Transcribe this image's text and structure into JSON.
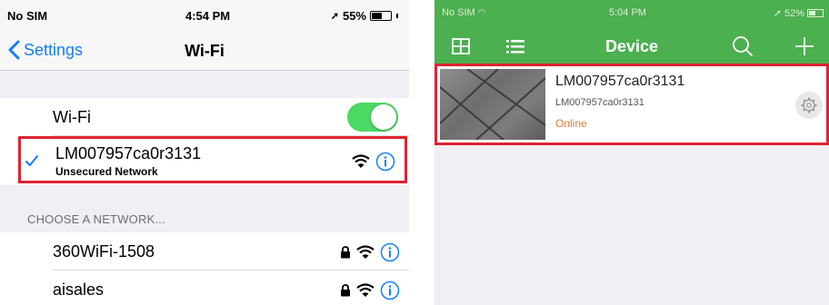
{
  "left": {
    "status": {
      "carrier": "No SIM",
      "time": "4:54 PM",
      "battery": "55%",
      "battery_level": 0.55
    },
    "nav": {
      "back_label": "Settings",
      "title": "Wi-Fi"
    },
    "wifi_toggle": {
      "label": "Wi-Fi",
      "on": true
    },
    "connected_network": {
      "name": "LM007957ca0r3131",
      "subtitle": "Unsecured Network"
    },
    "section_header": "CHOOSE A NETWORK...",
    "networks": [
      {
        "name": "360WiFi-1508",
        "secured": true
      },
      {
        "name": "aisales",
        "secured": true
      }
    ]
  },
  "right": {
    "status": {
      "carrier": "No SIM",
      "time": "5:04 PM",
      "battery": "52%",
      "battery_level": 0.52
    },
    "toolbar": {
      "title": "Device"
    },
    "device": {
      "name": "LM007957ca0r3131",
      "id": "LM007957ca0r3131",
      "status": "Online"
    }
  },
  "colors": {
    "ios_blue": "#157efb",
    "toggle_green": "#4cd964",
    "app_green": "#4caf50",
    "highlight_red": "#e02231",
    "online_orange": "#e07b3b"
  }
}
